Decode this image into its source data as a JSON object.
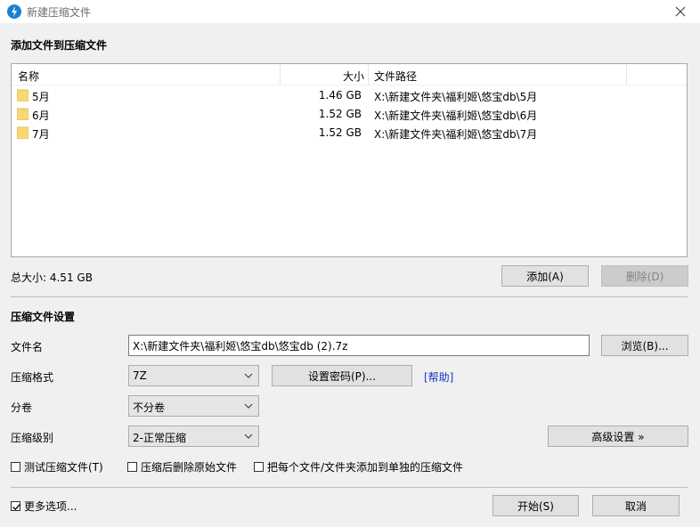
{
  "window": {
    "title": "新建压缩文件"
  },
  "add_section": {
    "title": "添加文件到压缩文件"
  },
  "file_list": {
    "columns": {
      "name": "名称",
      "size": "大小",
      "path": "文件路径"
    },
    "rows": [
      {
        "name": "5月",
        "size": "1.46 GB",
        "path": "X:\\新建文件夹\\福利姬\\悠宝db\\5月"
      },
      {
        "name": "6月",
        "size": "1.52 GB",
        "path": "X:\\新建文件夹\\福利姬\\悠宝db\\6月"
      },
      {
        "name": "7月",
        "size": "1.52 GB",
        "path": "X:\\新建文件夹\\福利姬\\悠宝db\\7月"
      }
    ]
  },
  "total_size": "总大小: 4.51 GB",
  "buttons": {
    "add": "添加(A)",
    "delete": "删除(D)",
    "browse": "浏览(B)...",
    "set_password": "设置密码(P)...",
    "advanced": "高级设置 »",
    "start": "开始(S)",
    "cancel": "取消"
  },
  "settings": {
    "title": "压缩文件设置",
    "filename_label": "文件名",
    "filename_value": "X:\\新建文件夹\\福利姬\\悠宝db\\悠宝db (2).7z",
    "format_label": "压缩格式",
    "format_value": "7Z",
    "help_link": "[帮助]",
    "split_label": "分卷",
    "split_value": "不分卷",
    "level_label": "压缩级别",
    "level_value": "2-正常压缩"
  },
  "options": {
    "test": {
      "label": "测试压缩文件(T)",
      "checked": false
    },
    "delete_after": {
      "label": "压缩后删除原始文件",
      "checked": false
    },
    "separate": {
      "label": "把每个文件/文件夹添加到单独的压缩文件",
      "checked": false
    },
    "more": {
      "label": "更多选项...",
      "checked": true
    }
  },
  "colors": {
    "accent": "#1b7fd6",
    "folder": "#f8d775",
    "link": "#1a33c8"
  }
}
